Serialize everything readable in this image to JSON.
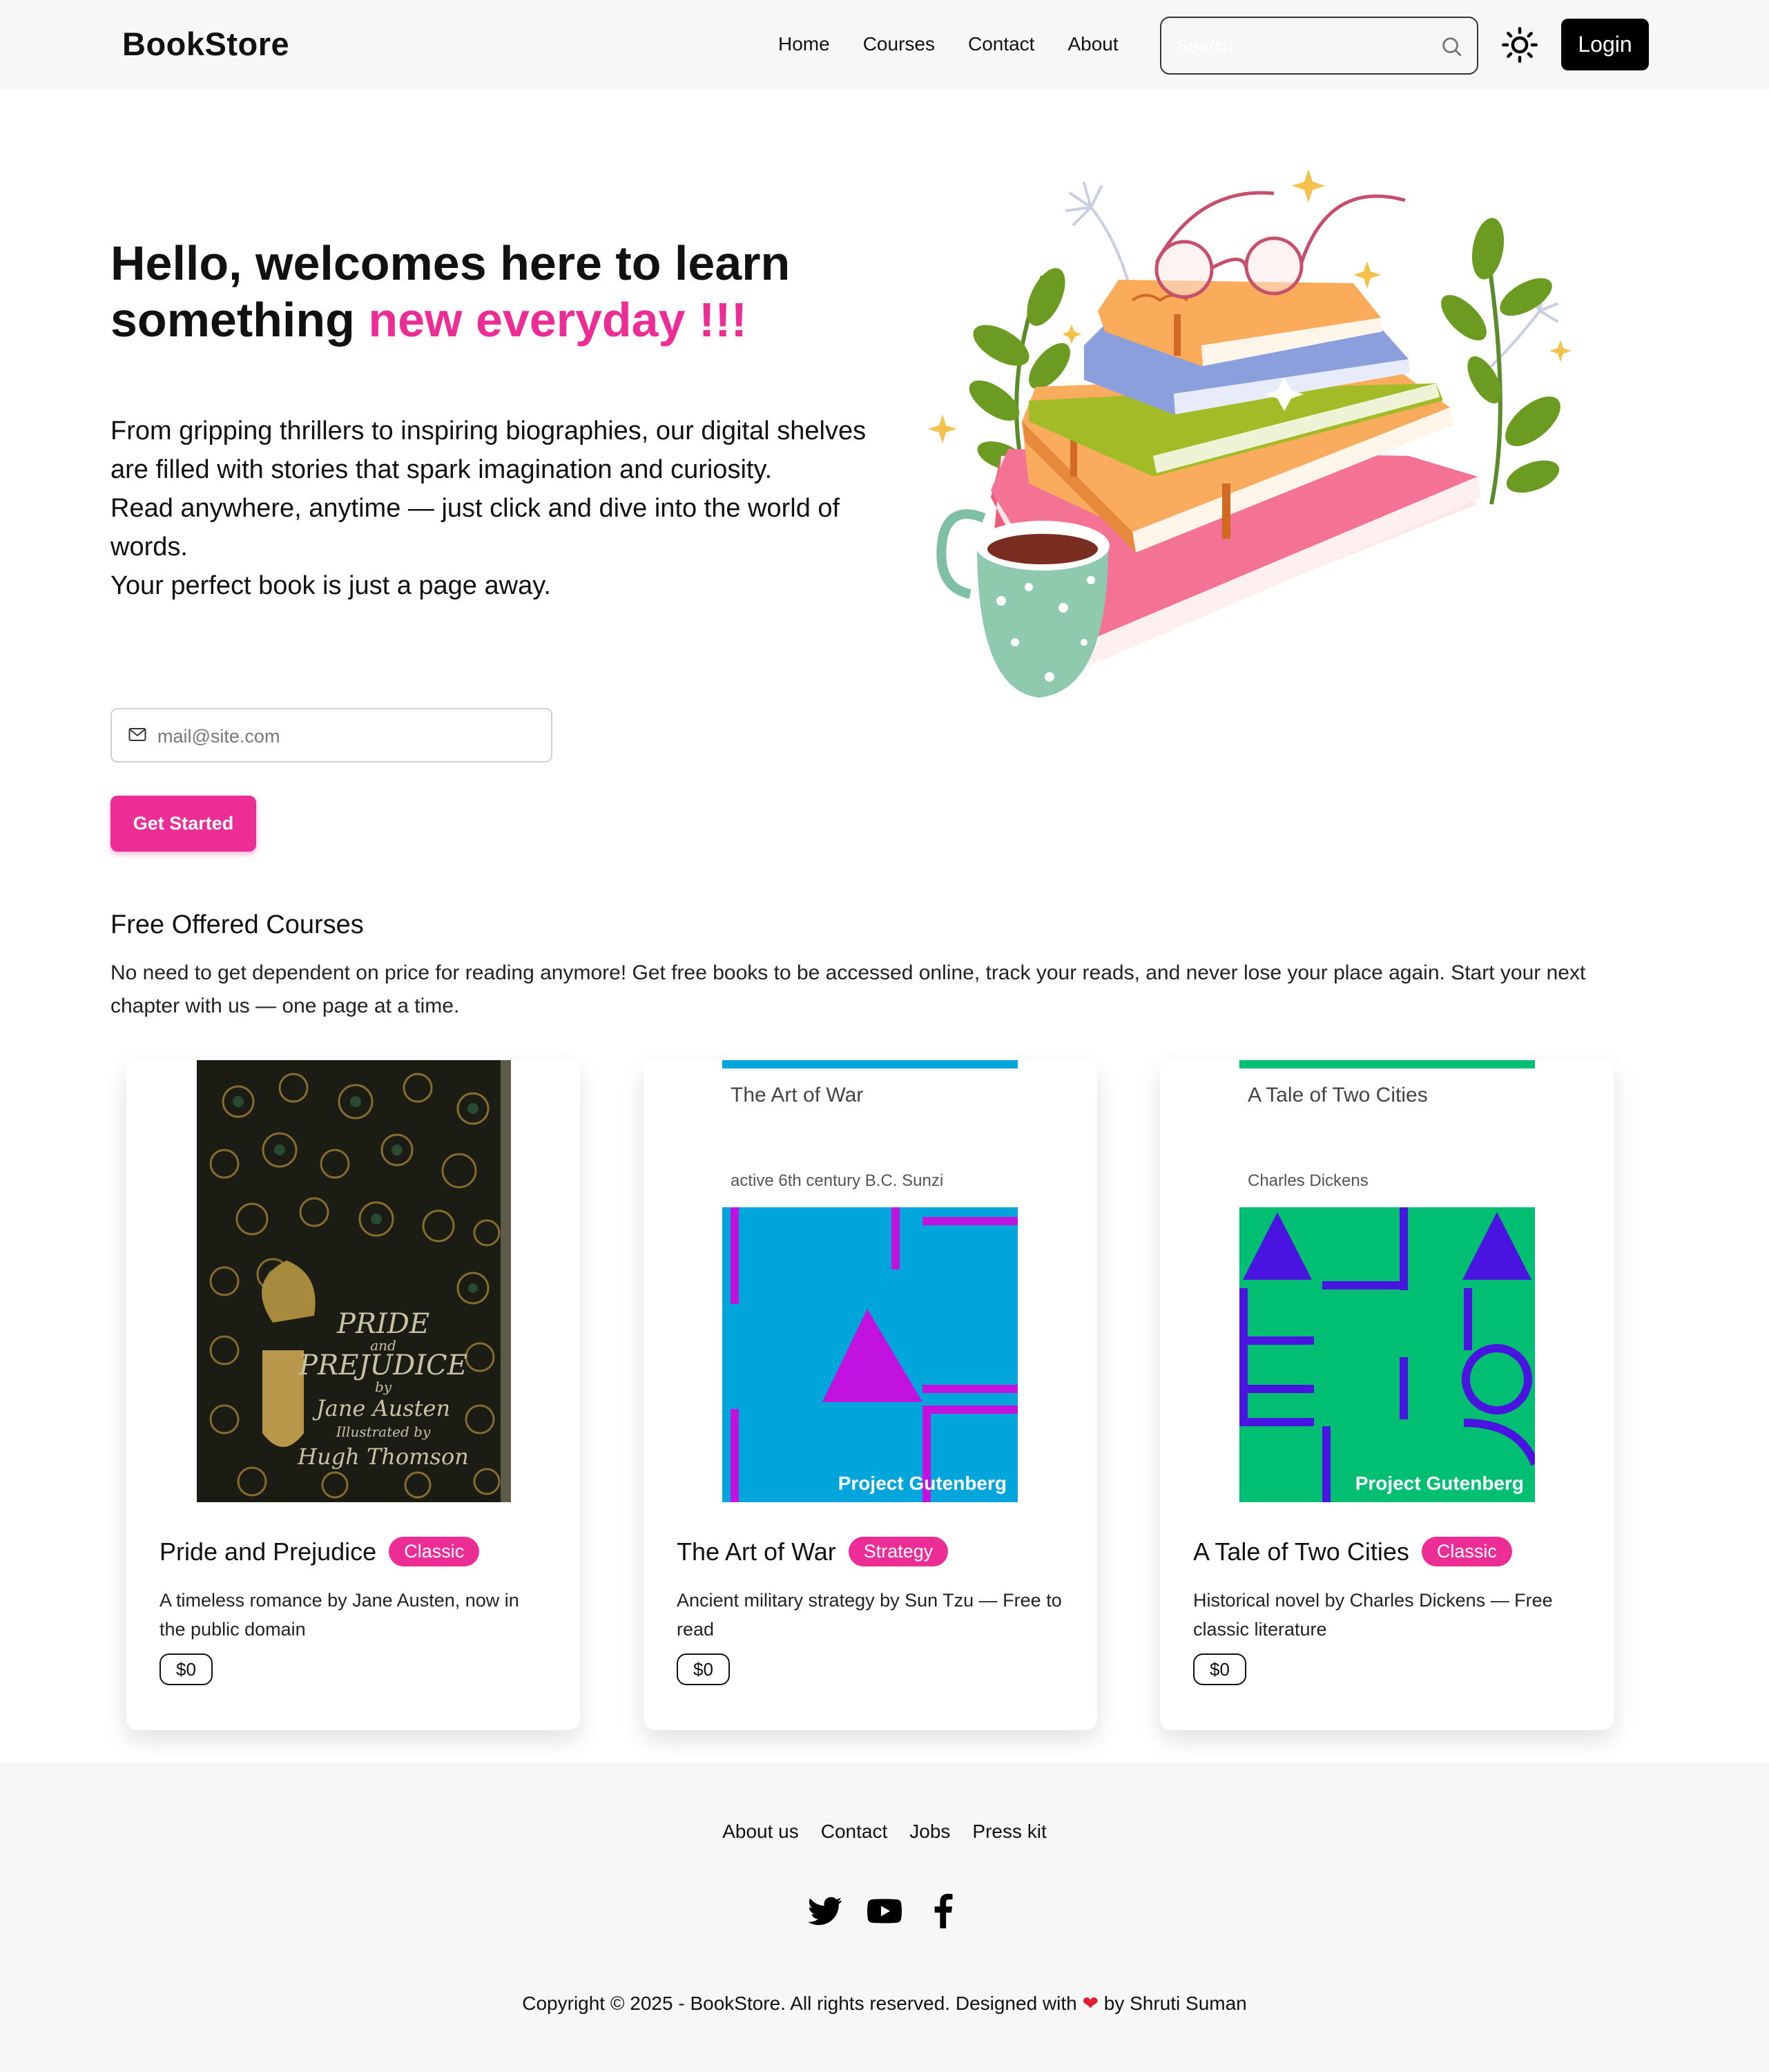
{
  "header": {
    "brand": "BookStore",
    "nav": [
      "Home",
      "Courses",
      "Contact",
      "About"
    ],
    "search_placeholder": "Search",
    "login_label": "Login"
  },
  "hero": {
    "title_line1": "Hello, welcomes here to learn",
    "title_line2_plain": "something ",
    "title_line2_accent": "new everyday !!!",
    "paragraphs": [
      "From gripping thrillers to inspiring biographies, our digital shelves are filled with stories that spark imagination and curiosity.",
      "Read anywhere, anytime — just click and dive into the world of words.",
      "Your perfect book is just a page away."
    ],
    "email_placeholder": "mail@site.com",
    "cta_label": "Get Started"
  },
  "courses": {
    "title": "Free Offered Courses",
    "description": "No need to get dependent on price for reading anymore! Get free books to be accessed online, track your reads, and never lose your place again. Start your next chapter with us — one page at a time.",
    "items": [
      {
        "title": "Pride and Prejudice",
        "badge": "Classic",
        "description": "A timeless romance by Jane Austen, now in the public domain",
        "price": "$0",
        "cover_text": [
          "PRIDE",
          "and",
          "PREJUDICE",
          "by",
          "Jane Austen",
          "Illustrated by",
          "Hugh Thomson"
        ]
      },
      {
        "title": "The Art of War",
        "badge": "Strategy",
        "description": "Ancient military strategy by Sun Tzu — Free to read",
        "price": "$0",
        "cover_title": "The Art of War",
        "cover_author": "active 6th century B.C. Sunzi",
        "cover_publisher": "Project Gutenberg",
        "cover_color": "#00a5dc",
        "cover_accent": "#c112e0"
      },
      {
        "title": "A Tale of Two Cities",
        "badge": "Classic",
        "description": "Historical novel by Charles Dickens — Free classic literature",
        "price": "$0",
        "cover_title": "A Tale of Two Cities",
        "cover_author": "Charles Dickens",
        "cover_publisher": "Project Gutenberg",
        "cover_color": "#00bf73",
        "cover_accent": "#4a14e0"
      }
    ]
  },
  "footer": {
    "links": [
      "About us",
      "Contact",
      "Jobs",
      "Press kit"
    ],
    "social_icons": [
      "twitter-icon",
      "youtube-icon",
      "facebook-icon"
    ],
    "copyright_before": "Copyright © 2025 - BookStore. All rights reserved. Designed with",
    "copyright_after": "by Shruti Suman"
  },
  "colors": {
    "accent": "#ec2d96",
    "dark": "#000000",
    "footer_bg": "#f7f7f7"
  }
}
